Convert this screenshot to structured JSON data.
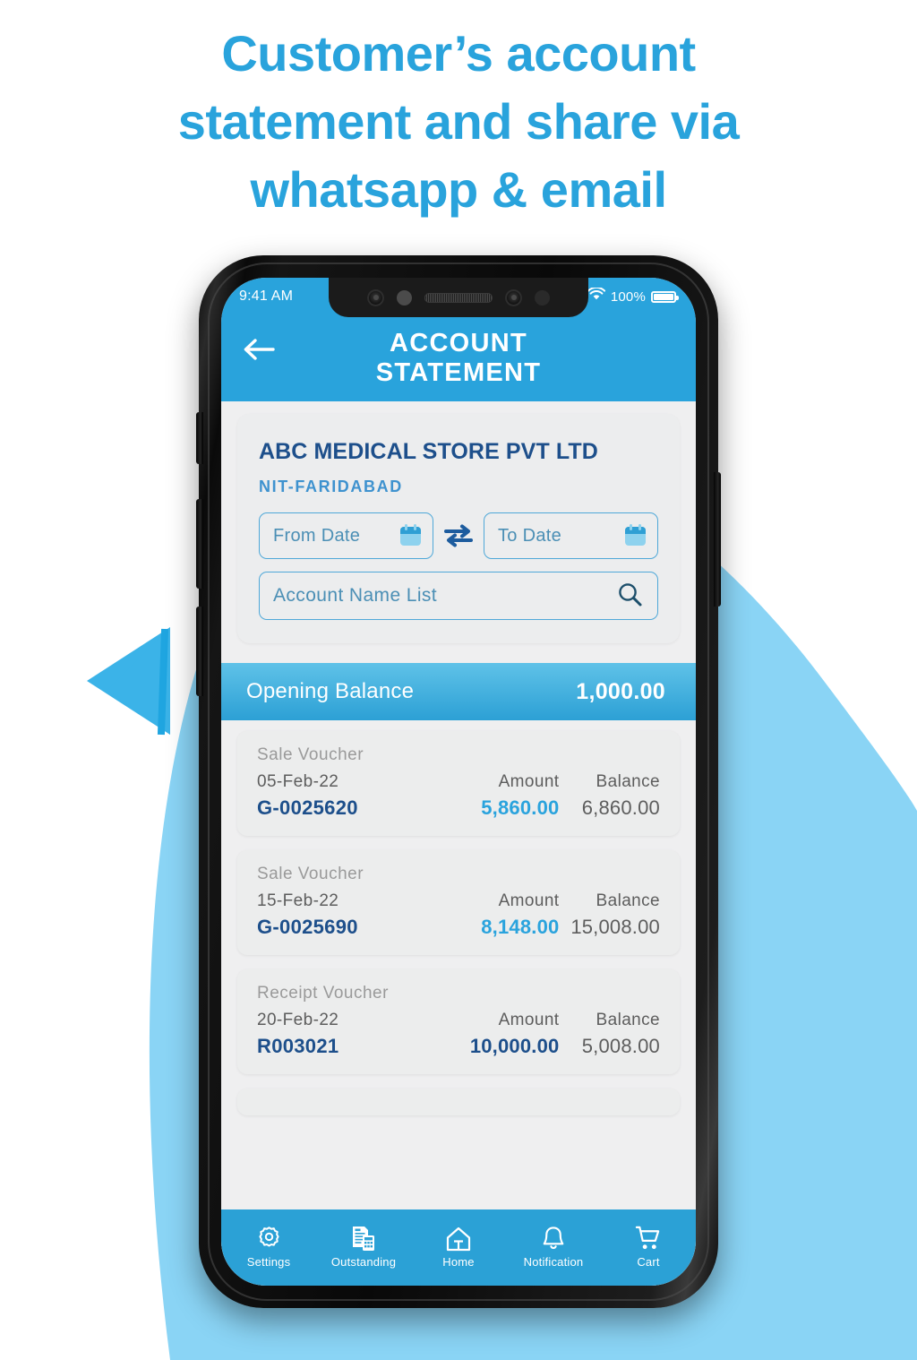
{
  "headline": {
    "line1": "Customer’s account",
    "line2": "statement and share via",
    "line3": "whatsapp & email"
  },
  "colors": {
    "brand_blue": "#29A3DC",
    "light_blue_blob": "#8AD4F5",
    "accent_triangle": "#3BB3E8",
    "deep_blue_text": "#1d4f8b",
    "screen_bg": "#efeff0"
  },
  "phone": {
    "status_bar": {
      "time": "9:41 AM",
      "battery_percent": "100%",
      "wifi_icon": "wifi-icon",
      "battery_icon": "battery-full-icon"
    },
    "header": {
      "back_icon": "back-arrow-icon",
      "title_line1": "ACCOUNT",
      "title_line2": "STATEMENT"
    },
    "filter_card": {
      "store_name": "ABC MEDICAL STORE PVT LTD",
      "branch": "NIT-FARIDABAD",
      "from_date_placeholder": "From Date",
      "to_date_placeholder": "To Date",
      "from_date_value": "",
      "to_date_value": "",
      "calendar_icon": "calendar-icon",
      "swap_icon": "swap-horizontal-icon",
      "account_search_placeholder": "Account Name List",
      "account_search_value": "",
      "search_icon": "search-icon"
    },
    "opening_balance": {
      "label": "Opening Balance",
      "value": "1,000.00"
    },
    "table_headers": {
      "amount": "Amount",
      "balance": "Balance"
    },
    "vouchers": [
      {
        "type": "Sale Voucher",
        "date": "05-Feb-22",
        "number": "G-0025620",
        "amount_label": "Amount",
        "balance_label": "Balance",
        "amount": "5,860.00",
        "balance": "6,860.00",
        "amount_color": "#2aa3dd"
      },
      {
        "type": "Sale Voucher",
        "date": "15-Feb-22",
        "number": "G-0025690",
        "amount_label": "Amount",
        "balance_label": "Balance",
        "amount": "8,148.00",
        "balance": "15,008.00",
        "amount_color": "#2aa3dd"
      },
      {
        "type": "Receipt Voucher",
        "date": "20-Feb-22",
        "number": "R003021",
        "amount_label": "Amount",
        "balance_label": "Balance",
        "amount": "10,000.00",
        "balance": "5,008.00",
        "amount_color": "#1d4f8b"
      }
    ],
    "bottom_nav": [
      {
        "label": "Settings",
        "icon": "gear-icon"
      },
      {
        "label": "Outstanding",
        "icon": "documents-calculator-icon"
      },
      {
        "label": "Home",
        "icon": "home-icon"
      },
      {
        "label": "Notification",
        "icon": "bell-icon"
      },
      {
        "label": "Cart",
        "icon": "shopping-cart-icon"
      }
    ]
  }
}
